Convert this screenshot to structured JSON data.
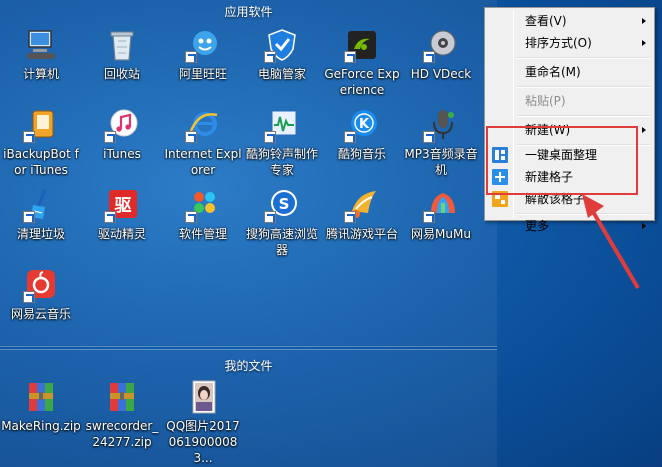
{
  "fences": {
    "top_title": "应用软件",
    "bottom_title": "我的文件"
  },
  "icons": [
    {
      "label": "计算机",
      "icon": "computer-icon"
    },
    {
      "label": "回收站",
      "icon": "recycle-bin-icon"
    },
    {
      "label": "阿里旺旺",
      "icon": "aliwangwang-icon"
    },
    {
      "label": "电脑管家",
      "icon": "pc-manager-icon"
    },
    {
      "label": "GeForce Experience",
      "icon": "geforce-icon"
    },
    {
      "label": "HD VDeck",
      "icon": "hd-vdeck-icon"
    },
    {
      "label": "iBackupBot for iTunes",
      "icon": "ibackupbot-icon"
    },
    {
      "label": "iTunes",
      "icon": "itunes-icon"
    },
    {
      "label": "Internet Explorer",
      "icon": "internet-explorer-icon"
    },
    {
      "label": "酷狗铃声制作专家",
      "icon": "kugou-ringtone-icon"
    },
    {
      "label": "酷狗音乐",
      "icon": "kugou-music-icon"
    },
    {
      "label": "MP3音频录音机",
      "icon": "mp3-recorder-icon"
    },
    {
      "label": "清理垃圾",
      "icon": "clean-trash-icon"
    },
    {
      "label": "驱动精灵",
      "icon": "driver-genius-icon"
    },
    {
      "label": "软件管理",
      "icon": "software-manager-icon"
    },
    {
      "label": "搜狗高速浏览器",
      "icon": "sogou-browser-icon"
    },
    {
      "label": "腾讯游戏平台",
      "icon": "tencent-games-icon"
    },
    {
      "label": "网易MuMu",
      "icon": "mumu-icon"
    },
    {
      "label": "网易云音乐",
      "icon": "netease-music-icon"
    }
  ],
  "files": [
    {
      "label": "MakeRing.zip",
      "icon": "zip-archive-icon"
    },
    {
      "label": "swrecorder_24277.zip",
      "icon": "zip-archive-icon"
    },
    {
      "label": "QQ图片20170619000083...",
      "icon": "image-thumbnail-icon"
    }
  ],
  "menu": {
    "view": "查看(V)",
    "sort": "排序方式(O)",
    "rename": "重命名(M)",
    "paste": "粘贴(P)",
    "new": "新建(W)",
    "organize": "一键桌面整理",
    "new_grid": "新建格子",
    "dissolve_grid": "解散该格子",
    "more": "更多"
  },
  "colors": {
    "desktop_bg": "#0f5aa8",
    "highlight_red": "#e03c3c"
  }
}
